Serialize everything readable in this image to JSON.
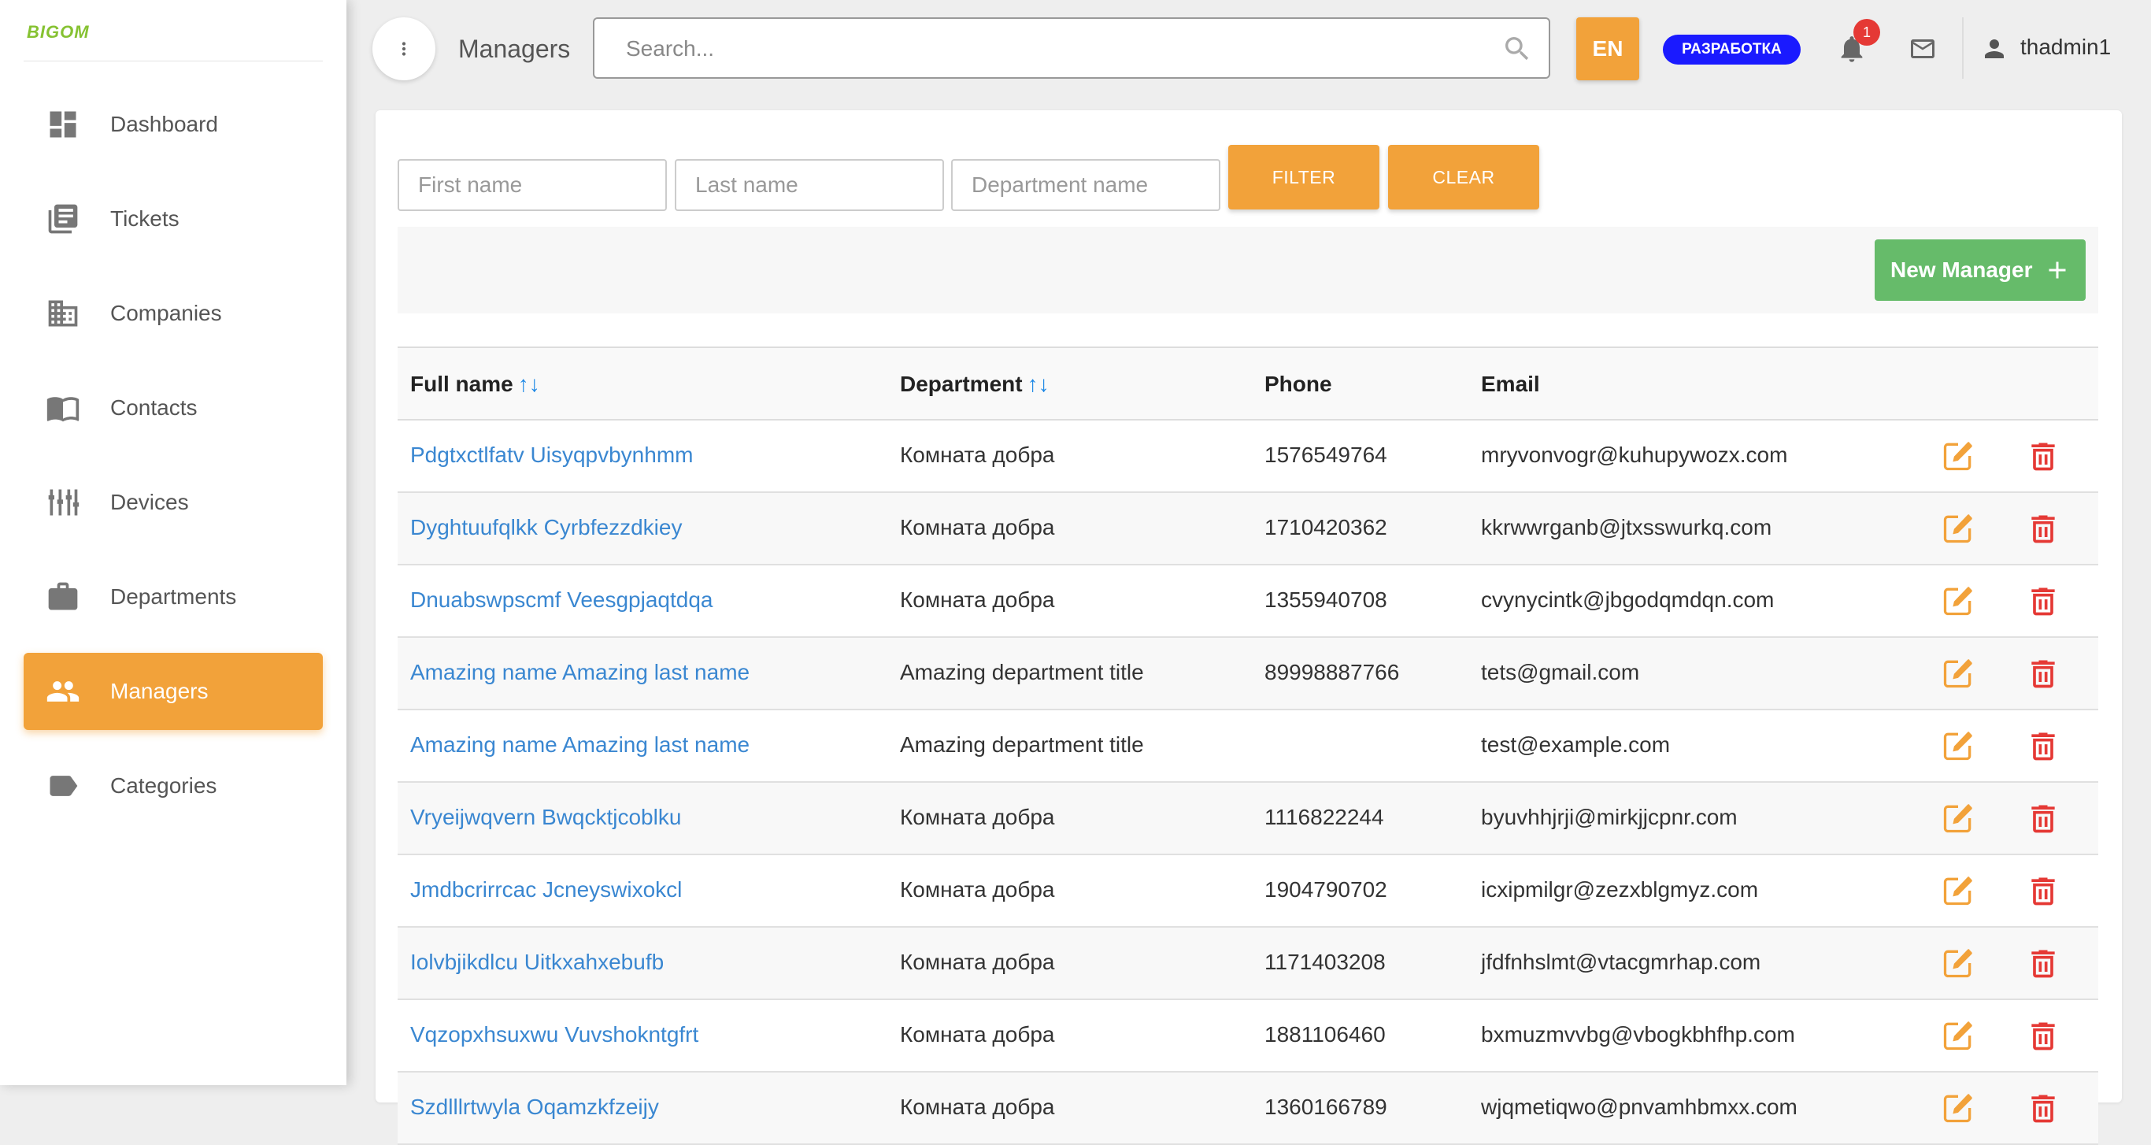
{
  "app": {
    "logo_text": "BIGOM"
  },
  "sidebar": {
    "items": [
      {
        "label": "Dashboard",
        "icon": "dashboard-icon"
      },
      {
        "label": "Tickets",
        "icon": "tickets-icon"
      },
      {
        "label": "Companies",
        "icon": "companies-icon"
      },
      {
        "label": "Contacts",
        "icon": "contacts-icon"
      },
      {
        "label": "Devices",
        "icon": "devices-icon"
      },
      {
        "label": "Departments",
        "icon": "departments-icon"
      },
      {
        "label": "Managers",
        "icon": "managers-icon",
        "active": true
      },
      {
        "label": "Categories",
        "icon": "categories-icon"
      }
    ]
  },
  "topbar": {
    "title": "Managers",
    "search_placeholder": "Search...",
    "lang": "EN",
    "env_badge": "РАЗРАБОТКА",
    "notifications": "1",
    "username": "thadmin1"
  },
  "filters": {
    "first_name_placeholder": "First name",
    "last_name_placeholder": "Last name",
    "department_placeholder": "Department name",
    "filter_label": "FILTER",
    "clear_label": "CLEAR"
  },
  "toolbar": {
    "new_label": "New Manager"
  },
  "table": {
    "headers": {
      "full_name": "Full name",
      "department": "Department",
      "phone": "Phone",
      "email": "Email",
      "sort_arrows": "↑↓"
    },
    "rows": [
      {
        "name": "Pdgtxctlfatv Uisyqpvbynhmm",
        "department": "Комната добра",
        "phone": "1576549764",
        "email": "mryvonvogr@kuhupywozx.com"
      },
      {
        "name": "Dyghtuufqlkk Cyrbfezzdkiey",
        "department": "Комната добра",
        "phone": "1710420362",
        "email": "kkrwwrganb@jtxsswurkq.com"
      },
      {
        "name": "Dnuabswpscmf Veesgpjaqtdqa",
        "department": "Комната добра",
        "phone": "1355940708",
        "email": "cvynycintk@jbgodqmdqn.com"
      },
      {
        "name": "Amazing name Amazing last name",
        "department": "Amazing department title",
        "phone": "89998887766",
        "email": "tets@gmail.com"
      },
      {
        "name": "Amazing name Amazing last name",
        "department": "Amazing department title",
        "phone": "",
        "email": "test@example.com"
      },
      {
        "name": "Vryeijwqvern Bwqcktjcoblku",
        "department": "Комната добра",
        "phone": "1116822244",
        "email": "byuvhhjrji@mirkjjcpnr.com"
      },
      {
        "name": "Jmdbcrirrcac Jcneyswixokcl",
        "department": "Комната добра",
        "phone": "1904790702",
        "email": "icxipmilgr@zezxblgmyz.com"
      },
      {
        "name": "Iolvbjikdlcu Uitkxahxebufb",
        "department": "Комната добра",
        "phone": "1171403208",
        "email": "jfdfnhslmt@vtacgmrhap.com"
      },
      {
        "name": "Vqzopxhsuxwu Vuvshokntgfrt",
        "department": "Комната добра",
        "phone": "1881106460",
        "email": "bxmuzmvvbg@vbogkbhfhp.com"
      },
      {
        "name": "Szdlllrtwyla Oqamzkfzeijy",
        "department": "Комната добра",
        "phone": "1360166789",
        "email": "wjqmetiqwo@pnvamhbmxx.com"
      }
    ]
  },
  "colors": {
    "accent": "#f2a23a",
    "link": "#3a87d1",
    "success": "#66bb6a",
    "danger": "#e53935",
    "badge": "#1a1aff"
  }
}
